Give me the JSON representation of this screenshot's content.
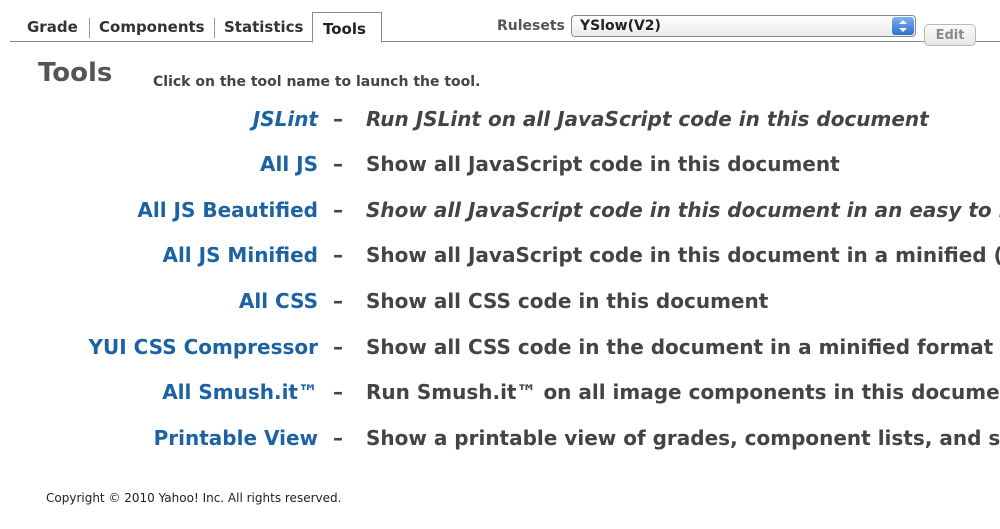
{
  "tabs": [
    {
      "label": "Grade"
    },
    {
      "label": "Components"
    },
    {
      "label": "Statistics"
    },
    {
      "label": "Tools",
      "active": true
    }
  ],
  "rulesets": {
    "label": "Rulesets",
    "selected": "YSlow(V2)",
    "edit_label": "Edit"
  },
  "main": {
    "title": "Tools",
    "intro": "Click on the tool name to launch the tool.",
    "dash": "–",
    "tools": [
      {
        "name": "JSLint",
        "description": "Run JSLint on all JavaScript code in this document"
      },
      {
        "name": "All JS",
        "description": "Show all JavaScript code in this document"
      },
      {
        "name": "All JS Beautified",
        "description": "Show all JavaScript code in this document in an easy to r"
      },
      {
        "name": "All JS Minified",
        "description": "Show all JavaScript code in this document in a minified ("
      },
      {
        "name": "All CSS",
        "description": "Show all CSS code in this document"
      },
      {
        "name": "YUI CSS Compressor",
        "description": "Show all CSS code in the document in a minified format"
      },
      {
        "name": "All Smush.it™",
        "description": "Run Smush.it™ on all image components in this documer"
      },
      {
        "name": "Printable View",
        "description": "Show a printable view of grades, component lists, and st"
      }
    ]
  },
  "footer": {
    "copyright": "Copyright © 2010 Yahoo! Inc. All rights reserved."
  },
  "colors": {
    "link": "#1d63a4",
    "select_arrow": "#2f6fd0"
  }
}
